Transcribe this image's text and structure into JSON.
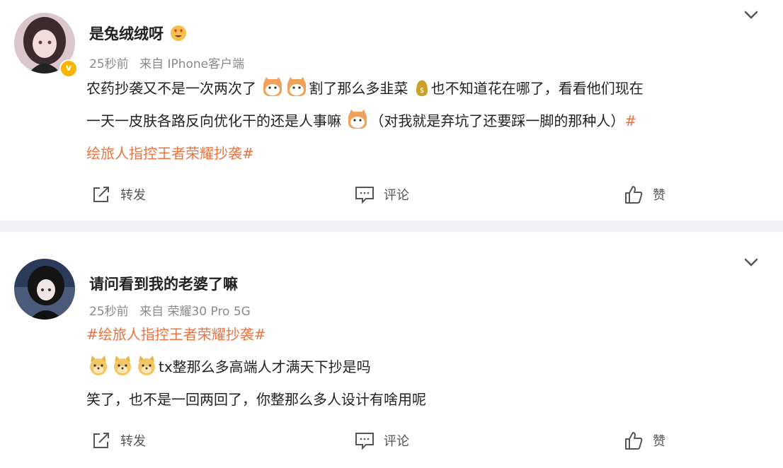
{
  "posts": [
    {
      "username": "是兔绒绒呀",
      "verified": true,
      "time": "25秒前",
      "source": "来自 IPhone客户端",
      "text": {
        "line1_a": "农药抄袭又不是一次两次了",
        "line1_b": "割了那么多韭菜",
        "line1_c": "也不知道花在哪了，看看他们现在",
        "line2_a": "一天一皮肤各路反向优化干的还是人事嘛",
        "line2_b": "（对我就是弃坑了还要踩一脚的那种人）",
        "line2_tag": "#",
        "line3_tag": "绘旅人指控王者荣耀抄袭#"
      },
      "actions": {
        "repost": "转发",
        "comment": "评论",
        "like": "赞"
      }
    },
    {
      "username": "请问看到我的老婆了嘛",
      "time": "25秒前",
      "source": "来自 荣耀30 Pro 5G",
      "text": {
        "tag": "#绘旅人指控王者荣耀抄袭#",
        "line2": "tx整那么多高端人才满天下抄是吗",
        "line3": "笑了，也不是一回两回了，你整那么多人设计有啥用呢"
      },
      "actions": {
        "repost": "转发",
        "comment": "评论",
        "like": "赞"
      }
    }
  ],
  "icons": [
    "chevron-down-icon",
    "verified-badge-icon",
    "heart-eyes-emoji",
    "cat-emoji",
    "money-bag-emoji",
    "doge-emoji",
    "repost-icon",
    "comment-icon",
    "like-icon"
  ],
  "colors": {
    "tag": "#eb7340",
    "meta": "#8a8a8a",
    "divider": "#f1f2f5",
    "verified": "#f7b500"
  }
}
